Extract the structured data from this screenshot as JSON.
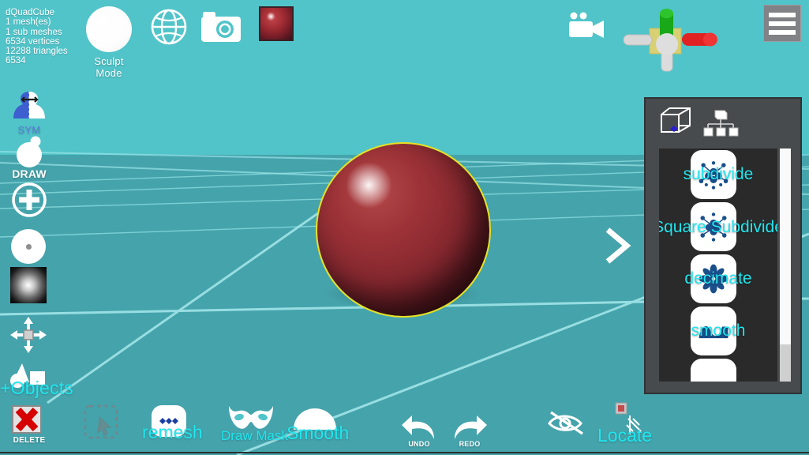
{
  "app": {
    "background_color": "#51c4c9",
    "floor_color": "#45a3ab",
    "accent_cyan": "#20e6ef",
    "selection_outline": "#e8e120"
  },
  "mesh_info": {
    "name": "dQuadCube",
    "meshes": "1 mesh(es)",
    "sub_meshes": "1 sub meshes",
    "vertices": "6534 vertices",
    "triangles": "12288 triangles",
    "extra_count": "6534"
  },
  "topbar": {
    "sculpt_mode": {
      "label": "Sculpt Mode",
      "icon": "sphere-icon"
    },
    "globe": {
      "icon": "globe-icon"
    },
    "camera": {
      "icon": "camera-icon"
    },
    "material_swatch": {
      "icon": "material-sphere-icon",
      "color": "#a52e35"
    },
    "camera_gizmo": {
      "icon": "video-camera-icon"
    },
    "transform_gizmo": {
      "icon": "transform-gizmo-icon",
      "axis_x_color": "#e02020",
      "axis_y_color": "#1fa81f",
      "axis_z_color": "#d6d6d6",
      "plane_color": "#d8cf6a"
    },
    "menu": {
      "icon": "hamburger-menu-icon",
      "bars": 3
    }
  },
  "left_toolbar": {
    "items": [
      {
        "label": "SYM",
        "icon": "symmetry-icon"
      },
      {
        "label": "DRAW",
        "icon": "draw-brush-icon"
      },
      {
        "label": "",
        "icon": "plus-circle-icon"
      },
      {
        "label": "",
        "icon": "brush-radius-icon"
      },
      {
        "label": "",
        "icon": "brush-falloff-icon"
      },
      {
        "label": "",
        "icon": "move-gizmo-icon"
      },
      {
        "label": "+Objects",
        "icon": "add-objects-icon"
      }
    ]
  },
  "viewport": {
    "next_chevron": {
      "icon": "chevron-right-icon"
    },
    "object": {
      "name": "dQuadCube",
      "selected": true
    }
  },
  "right_panel": {
    "header": {
      "cube_icon": "wireframe-cube-icon",
      "tree_icon": "scene-hierarchy-icon"
    },
    "items": [
      {
        "label": "subdivide",
        "icon": "subdivide-icon"
      },
      {
        "label": "Square Subdivide",
        "icon": "square-subdivide-icon"
      },
      {
        "label": "decimate",
        "icon": "decimate-icon"
      },
      {
        "label": "smooth",
        "icon": "smooth-wave-icon"
      },
      {
        "label": "",
        "icon": "next-tool-icon"
      }
    ],
    "scrollbar": {
      "visible": true
    }
  },
  "bottom_bar": {
    "items": [
      {
        "label": "DELETE",
        "icon": "delete-x-icon",
        "enabled": true
      },
      {
        "label": "",
        "icon": "marquee-select-icon",
        "enabled": false
      },
      {
        "label": "remesh",
        "icon": "remesh-icon",
        "enabled": true
      },
      {
        "label": "Draw Mask",
        "icon": "mask-icon",
        "enabled": true
      },
      {
        "label": "Smooth",
        "icon": "smooth-dome-icon",
        "enabled": true
      },
      {
        "label": "UNDO",
        "icon": "undo-arrow-icon",
        "enabled": true
      },
      {
        "label": "REDO",
        "icon": "redo-arrow-icon",
        "enabled": true
      },
      {
        "label": "",
        "icon": "hide-eye-icon",
        "enabled": true
      },
      {
        "label": "Locate",
        "icon": "locate-icon",
        "enabled": true
      }
    ]
  }
}
